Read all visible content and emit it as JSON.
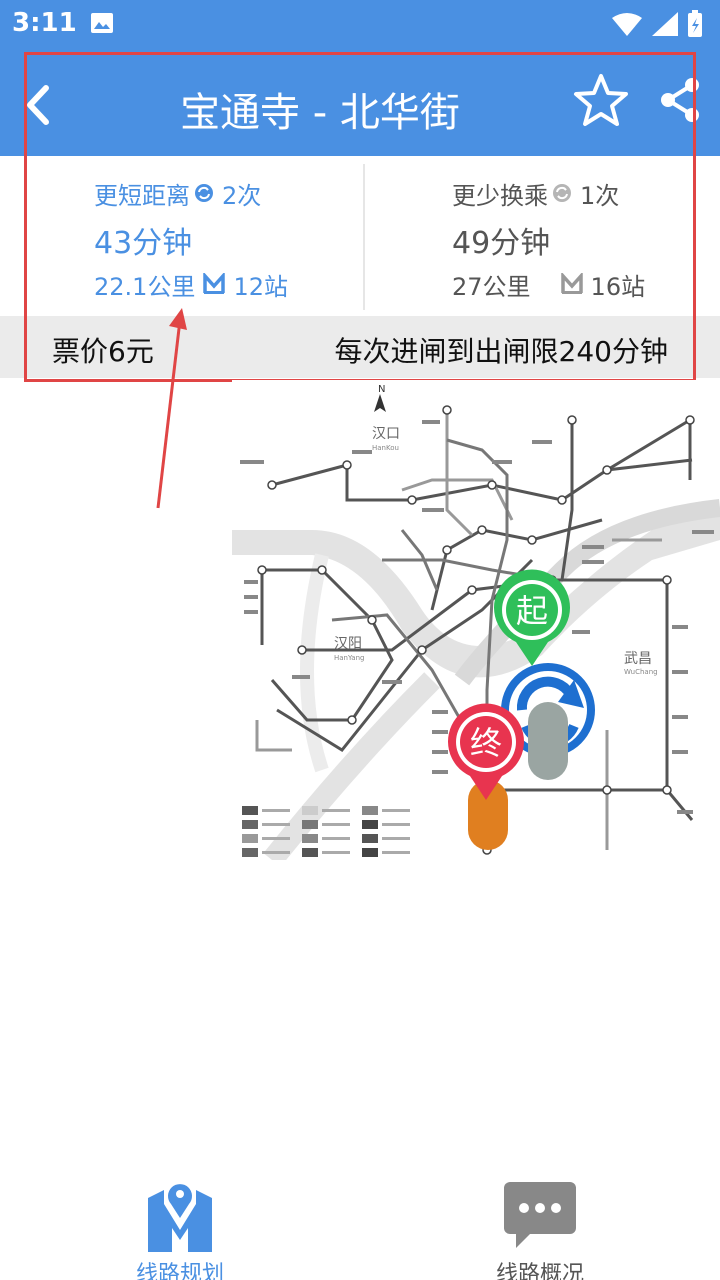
{
  "status_bar": {
    "time": "3:11"
  },
  "header": {
    "title": "宝通寺 - 北华街"
  },
  "routes": [
    {
      "option": "更短距离",
      "transfers": "2次",
      "duration": "43分钟",
      "distance": "22.1公里",
      "stations": "12站"
    },
    {
      "option": "更少换乘",
      "transfers": "1次",
      "duration": "49分钟",
      "distance": "27公里",
      "stations": "16站"
    }
  ],
  "fare": {
    "price": "票价6元",
    "limit": "每次进闸到出闸限240分钟"
  },
  "map": {
    "labels": {
      "north": "N",
      "hankou": "汉口",
      "hankou_en": "HanKou",
      "hanyang": "汉阳",
      "hanyang_en": "HanYang",
      "wuchang": "武昌",
      "wuchang_en": "WuChang"
    },
    "start_marker": "起",
    "end_marker": "终"
  },
  "bottom_nav": [
    {
      "label": "线路规划"
    },
    {
      "label": "线路概况"
    }
  ],
  "colors": {
    "primary": "#4a90e2",
    "start": "#2fbf5a",
    "end": "#e8344f",
    "highlight": "#e04545"
  }
}
